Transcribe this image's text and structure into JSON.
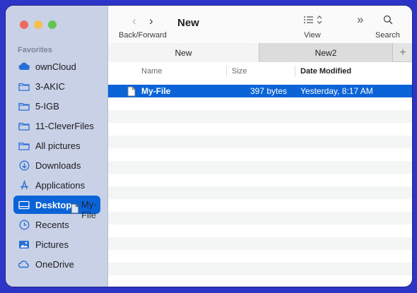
{
  "window": {
    "title": "New"
  },
  "toolbar": {
    "back_label": "Back/Forward",
    "view_label": "View",
    "search_label": "Search"
  },
  "tabs": [
    {
      "label": "New"
    },
    {
      "label": "New2"
    }
  ],
  "sidebar": {
    "section_title": "Favorites",
    "items": [
      {
        "label": "ownCloud",
        "icon": "cloud-icon"
      },
      {
        "label": "3-AKIC",
        "icon": "folder-icon"
      },
      {
        "label": "5-IGB",
        "icon": "folder-icon"
      },
      {
        "label": "11-CleverFiles",
        "icon": "folder-icon"
      },
      {
        "label": "All pictures",
        "icon": "folder-icon"
      },
      {
        "label": "Downloads",
        "icon": "download-icon"
      },
      {
        "label": "Applications",
        "icon": "applications-icon"
      },
      {
        "label": "Desktop",
        "icon": "desktop-icon",
        "selected": true
      },
      {
        "label": "Recents",
        "icon": "clock-icon"
      },
      {
        "label": "Pictures",
        "icon": "photo-icon"
      },
      {
        "label": "OneDrive",
        "icon": "onedrive-icon"
      }
    ]
  },
  "drag_ghost": {
    "label": "My-File"
  },
  "columns": {
    "name": "Name",
    "size": "Size",
    "date": "Date Modified"
  },
  "files": [
    {
      "name": "My-File",
      "size": "397 bytes",
      "date": "Yesterday, 8:17 AM",
      "selected": true
    }
  ],
  "colors": {
    "accent": "#0a64d8",
    "sidebar_bg": "#c8d1e6",
    "icon_blue": "#2a6fd6"
  }
}
